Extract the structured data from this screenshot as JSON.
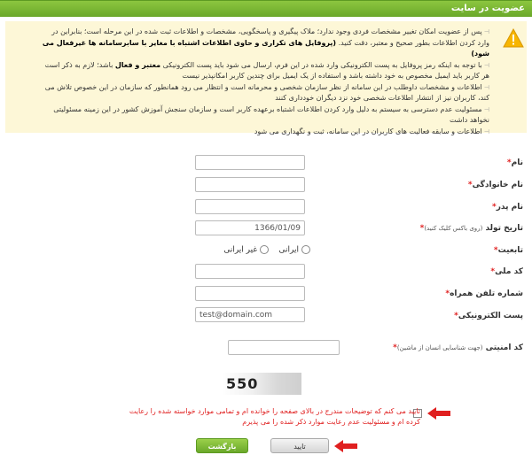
{
  "header": {
    "title": "عضویت در سایت"
  },
  "notice": {
    "items": [
      [
        "پس از عضویت امکان تغییر مشخصات فردی وجود ندارد؛ ملاک پیگیری و پاسخگویی، مشخصات و اطلاعات ثبت شده در این مرحله است؛ بنابراین در وارد کردن اطلاعات بطور صحیح و معتبر، دقت کنید. ",
        "(پروفایل های تکراری و حاوی اطلاعات اشتباه با مغایر با سابرسامانه ها غیرفعال می شود)",
        ""
      ],
      [
        "با توجه به اینکه رمز پروفایل به پست الکترونیکی وارد شده در این فرم، ارسال می شود باید پست الکترونیکی ",
        "معتبر و فعال",
        " باشد؛ لازم به ذکر است هر کاربر باید ایمیل مخصوص به خود داشته باشد و استفاده از یک ایمیل برای چندین کاربر امکانپذیر نیست"
      ],
      [
        "اطلاعات و مشخصات داوطلب در این سامانه از نظر سازمان شخصی و محرمانه است و انتظار می رود همانطور که سازمان در این خصوص تلاش می کند، کاربران نیز از انتشار اطلاعات شخصی خود نزد دیگران خودداری کنند",
        "",
        ""
      ],
      [
        "مسئولیت عدم دسترسی به سیستم به دلیل وارد کردن اطلاعات اشتباه برعهده کاربر است و سازمان سنجش آموزش کشور در این زمینه مسئولیتی نخواهد داشت",
        "",
        ""
      ],
      [
        "اطلاعات و سابقه فعالیت های کاربران در این سامانه، ثبت و نگهداری می شود",
        "",
        ""
      ]
    ]
  },
  "form": {
    "first_name": {
      "label": "نام",
      "value": ""
    },
    "last_name": {
      "label": "نام خانوادگی",
      "value": ""
    },
    "father_name": {
      "label": "نام پدر",
      "value": ""
    },
    "birth_date": {
      "label": "تاریخ تولد",
      "hint": "(روی باکس کلیک کنید)",
      "value": "1366/01/09"
    },
    "nationality": {
      "label": "تابعیت",
      "options": [
        "ایرانی",
        "غیر ایرانی"
      ]
    },
    "national_code": {
      "label": "کد ملی",
      "value": ""
    },
    "mobile": {
      "label": "شماره تلفن همراه",
      "value": ""
    },
    "email": {
      "label": "پست الکترونیکی",
      "value": "test@domain.com"
    },
    "security_code": {
      "label": "کد امنیتی",
      "hint": "(جهت شناسایی انسان از ماشین)",
      "value": ""
    },
    "required_mark": "*"
  },
  "captcha": {
    "text": "550"
  },
  "agree": {
    "text": "تایید می کنم که توضیحات مندرج در بالای صفحه را خوانده ام و تمامی موارد خواسته شده را رعایت کرده ام و مسئولیت عدم رعایت موارد ذکر شده را می پذیرم"
  },
  "buttons": {
    "back": "بازگشت",
    "confirm": "تایید"
  },
  "colors": {
    "accent": "#6aa82a",
    "required": "#e02020",
    "notice_bg": "#fdf7d7",
    "arrow": "#e02020"
  }
}
